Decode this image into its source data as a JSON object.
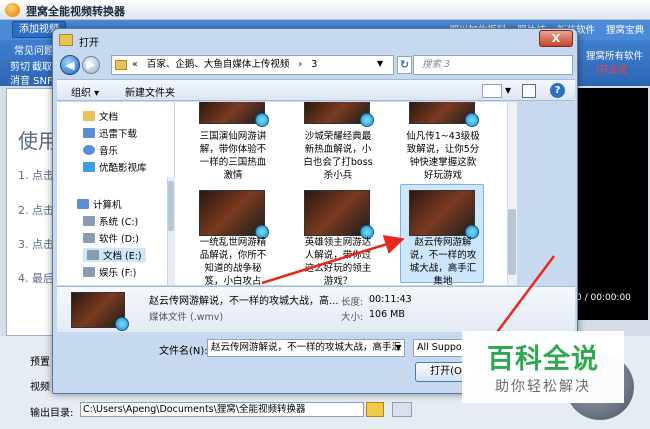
{
  "app": {
    "title": "狸窝全能视频转换器",
    "add_video": "添加视频",
    "top_links": [
      "吧以加佐扳料",
      "照片结",
      "新装软件",
      "狸窝宝典"
    ],
    "menu_row1": "常见问题",
    "menu_row2": [
      "剪切",
      "截取"
    ],
    "menu_row3": "消音 SNF",
    "right_links": [
      "狸窝所有软件",
      "|开会员"
    ],
    "panel": {
      "title": "使用",
      "steps": [
        "1. 点击",
        "2. 点击",
        "3. 点击",
        "4. 最后"
      ]
    },
    "preview_time": "0 / 00:00:00",
    "bottom": {
      "preset_label": "预置",
      "video_label": "视频",
      "output_label": "输出目录:",
      "output_path": "C:\\Users\\Apeng\\Documents\\狸窝\\全能视频转换器"
    }
  },
  "dialog": {
    "title": "打开",
    "close": "X",
    "address": {
      "segments": [
        "«",
        "百家、企鹅、大鱼自媒体上传视频",
        "›",
        "3"
      ]
    },
    "search_placeholder": "搜索 3",
    "commands": {
      "organize": "组织 ▾",
      "new_folder": "新建文件夹"
    },
    "nav": [
      {
        "label": "文档",
        "icon": "document-icon",
        "color": "#e8c35a"
      },
      {
        "label": "迅雷下载",
        "icon": "thunder-icon",
        "color": "#5a8ed6"
      },
      {
        "label": "音乐",
        "icon": "music-icon",
        "color": "#5a8ed6"
      },
      {
        "label": "优酷影视库",
        "icon": "youku-icon",
        "color": "#3aa0e0"
      },
      {
        "label": "计算机",
        "icon": "computer-icon",
        "color": "#5a8ed6"
      },
      {
        "label": "系统 (C:)",
        "icon": "drive-icon",
        "color": "#8a9bb0"
      },
      {
        "label": "软件 (D:)",
        "icon": "drive-icon",
        "color": "#8a9bb0"
      },
      {
        "label": "文档 (E:)",
        "icon": "drive-icon",
        "color": "#8a9bb0"
      },
      {
        "label": "娱乐 (F:)",
        "icon": "drive-icon",
        "color": "#8a9bb0"
      }
    ],
    "files_row1": [
      {
        "lines": [
          "三国演仙网游讲",
          "解，带你体验不",
          "一样的三国热血",
          "激情"
        ]
      },
      {
        "lines": [
          "沙城荣耀经典最",
          "新热血解说，小",
          "白也会了打boss",
          "杀小兵"
        ]
      },
      {
        "lines": [
          "仙凡传1~43级极",
          "致解说，让你5分",
          "钟快速掌握这款",
          "好玩游戏"
        ]
      }
    ],
    "files_row2": [
      {
        "lines": [
          "一统乱世网游精",
          "品解说，你所不",
          "知道的战争秘",
          "笈，小白攻占"
        ]
      },
      {
        "lines": [
          "英雄领主网游达",
          "人解说，带你过",
          "这么好玩的领主",
          "游戏？"
        ]
      },
      {
        "lines": [
          "赵云传网游解",
          "说，不一样的攻",
          "城大战，高手汇",
          "集地"
        ]
      }
    ],
    "details": {
      "name": "赵云传网游解说，不一样的攻城大战，高...",
      "type": "媒体文件 (.wmv)",
      "length_label": "长度:",
      "length": "00:11:43",
      "size_label": "大小:",
      "size": "106 MB"
    },
    "filename_label": "文件名(N):",
    "filename_value": "赵云传网游解说，不一样的攻城大战，高手汇",
    "filetype_value": "All Suppor",
    "open_button": "打开(O"
  },
  "watermark": {
    "title": "百科全说",
    "subtitle": "助你轻松解决"
  },
  "colors": {
    "app_blue": "#2d66b3",
    "arrow_red": "#e8281e",
    "selection": "#cde6fb",
    "watermark_green": "#2fa84f"
  }
}
